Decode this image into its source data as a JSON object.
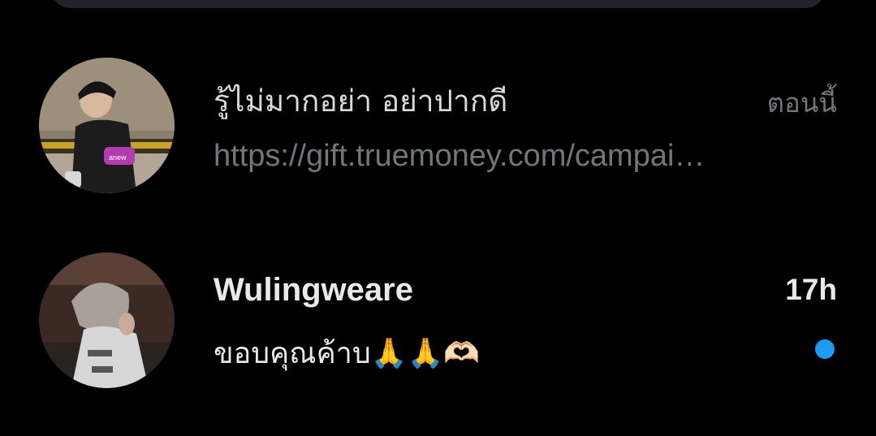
{
  "conversations": [
    {
      "name": "รู้ไม่มากอย่า อย่าปากดี",
      "timestamp": "ตอนนี้",
      "preview": "https://gift.truemoney.com/campai…",
      "unread": false
    },
    {
      "name": "Wulingweare",
      "timestamp": "17h",
      "preview": "ขอบคุณค้าบ🙏🙏🫶🏻",
      "unread": true
    }
  ],
  "colors": {
    "background": "#000000",
    "search_bar": "#202327",
    "primary_text": "#e7e9ea",
    "secondary_text": "#71767b",
    "unread_dot": "#1d9bf0"
  }
}
